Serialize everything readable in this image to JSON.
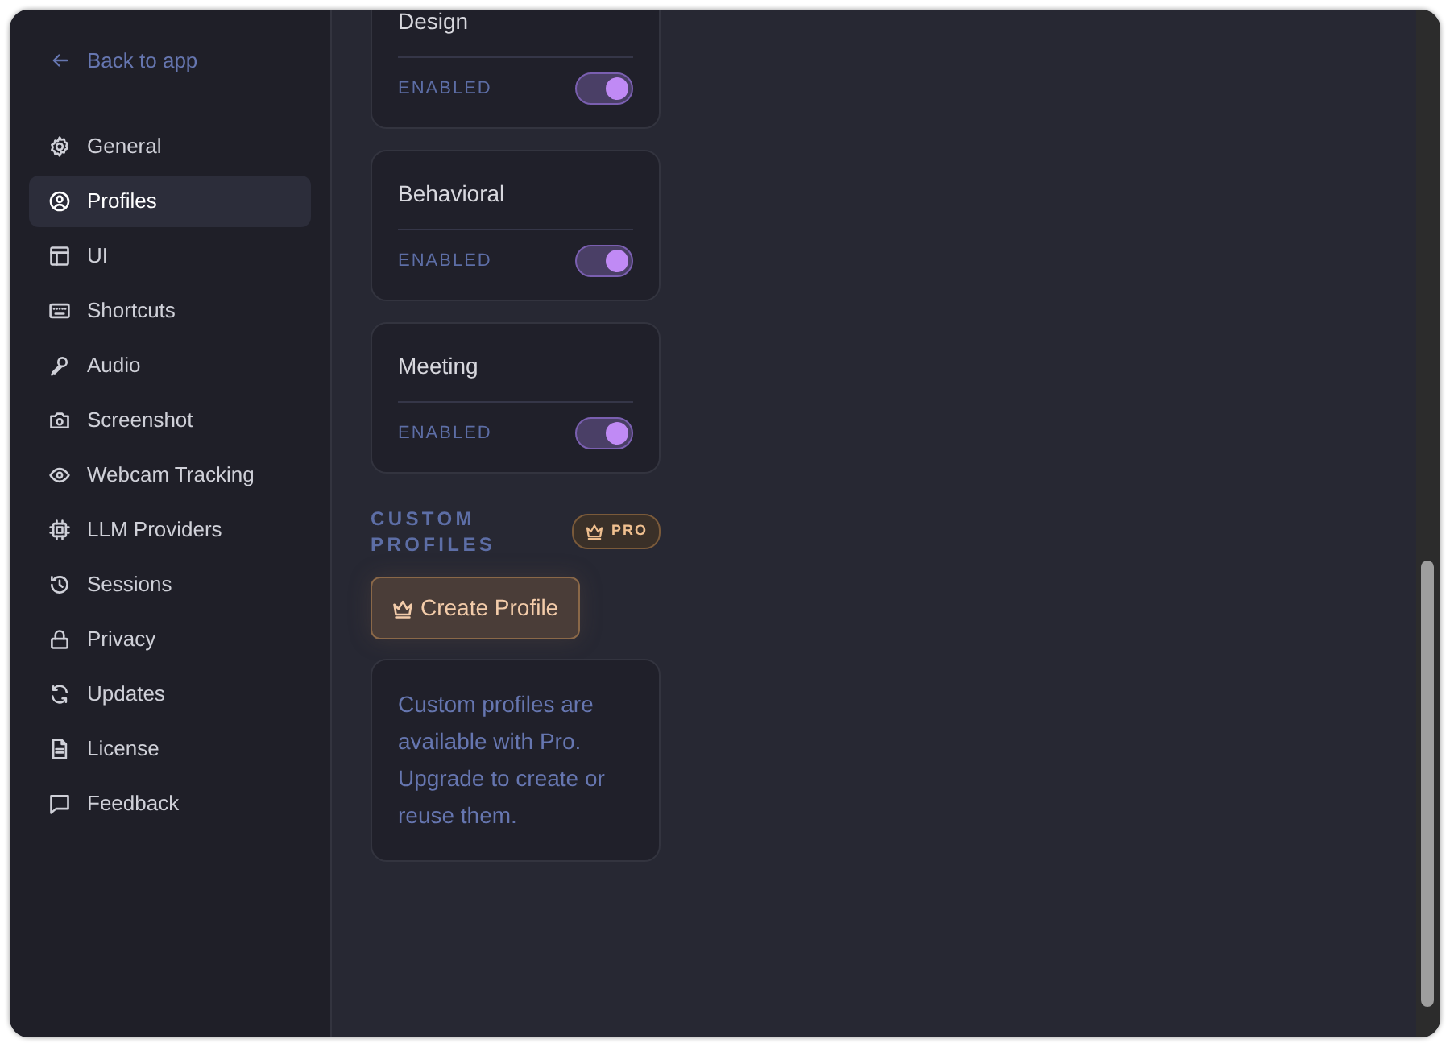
{
  "sidebar": {
    "back_link": "Back to app",
    "items": [
      {
        "label": "General",
        "selected": false
      },
      {
        "label": "Profiles",
        "selected": true
      },
      {
        "label": "UI",
        "selected": false
      },
      {
        "label": "Shortcuts",
        "selected": false
      },
      {
        "label": "Audio",
        "selected": false
      },
      {
        "label": "Screenshot",
        "selected": false
      },
      {
        "label": "Webcam Tracking",
        "selected": false
      },
      {
        "label": "LLM Providers",
        "selected": false
      },
      {
        "label": "Sessions",
        "selected": false
      },
      {
        "label": "Privacy",
        "selected": false
      },
      {
        "label": "Updates",
        "selected": false
      },
      {
        "label": "License",
        "selected": false
      },
      {
        "label": "Feedback",
        "selected": false
      }
    ]
  },
  "profiles": [
    {
      "name": "Design",
      "status": "ENABLED",
      "on": true
    },
    {
      "name": "Behavioral",
      "status": "ENABLED",
      "on": true
    },
    {
      "name": "Meeting",
      "status": "ENABLED",
      "on": true
    }
  ],
  "custom_profiles": {
    "heading": "CUSTOM PROFILES",
    "badge": "PRO",
    "button": "Create Profile",
    "message": "Custom profiles are available with Pro. Upgrade to create or reuse them."
  }
}
